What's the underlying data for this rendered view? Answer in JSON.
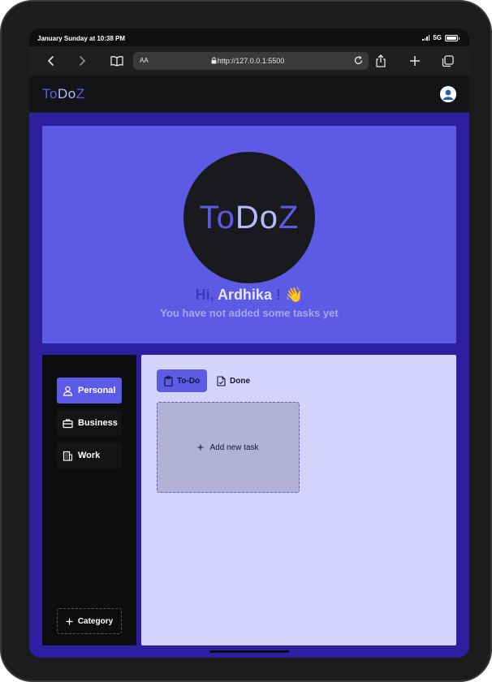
{
  "status_bar": {
    "time": "January Sunday at 10:38 PM",
    "network": "5G"
  },
  "browser": {
    "aa_label": "AA",
    "url": "http://127.0.0.1:5500"
  },
  "app": {
    "logo_parts": [
      "To",
      "Do",
      "Z"
    ],
    "logo_colors": [
      "#5b5be6",
      "#b9b9ff",
      "#5b5be6"
    ]
  },
  "hero": {
    "logo_parts": [
      "To",
      "Do",
      "Z"
    ],
    "greeting_hi": "Hi,",
    "user_name": "Ardhika",
    "greeting_end": "!",
    "wave": "👋",
    "subtitle": "You have not added some tasks yet"
  },
  "sidebar": {
    "categories": [
      {
        "label": "Personal",
        "icon": "user-icon",
        "active": true
      },
      {
        "label": "Business",
        "icon": "briefcase-icon",
        "active": false
      },
      {
        "label": "Work",
        "icon": "building-icon",
        "active": false
      }
    ],
    "add_category_label": "Category"
  },
  "tabs": [
    {
      "label": "To-Do",
      "icon": "clipboard-icon",
      "active": true
    },
    {
      "label": "Done",
      "icon": "file-check-icon",
      "active": false
    }
  ],
  "task_card": {
    "label": "Add new task"
  },
  "colors": {
    "accent": "#5b5be6",
    "content_bg": "#2d1fa0",
    "main_bg": "#d4d3fb",
    "dark": "#0d0d0f"
  }
}
